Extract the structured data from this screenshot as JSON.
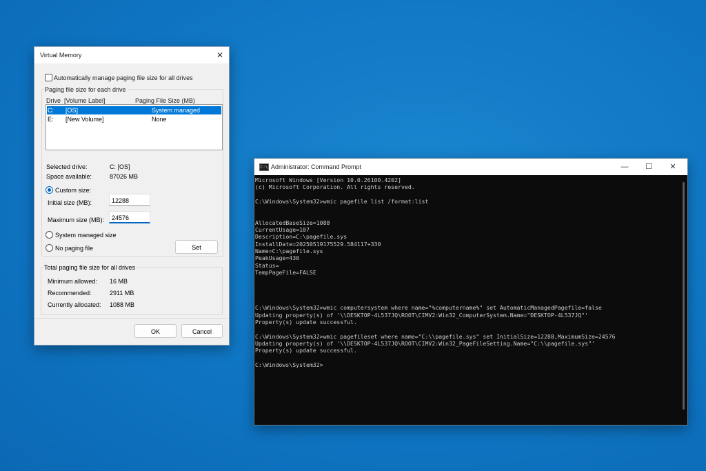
{
  "vm_dialog": {
    "title": "Virtual Memory",
    "auto_manage_label": "Automatically manage paging file size for all drives",
    "auto_manage_checked": false,
    "group_label": "Paging file size for each drive",
    "col_drive": "Drive",
    "col_volume": "[Volume Label]",
    "col_size": "Paging File Size (MB)",
    "drives": [
      {
        "drive": "C:",
        "label": "[OS]",
        "size": "System managed",
        "selected": true
      },
      {
        "drive": "E:",
        "label": "[New Volume]",
        "size": "None",
        "selected": false
      }
    ],
    "selected_drive_label": "Selected drive:",
    "selected_drive_value": "C:  [OS]",
    "space_available_label": "Space available:",
    "space_available_value": "87026 MB",
    "custom_size_label": "Custom size:",
    "initial_size_label": "Initial size (MB):",
    "initial_size_value": "12288",
    "max_size_label": "Maximum size (MB):",
    "max_size_value": "24576",
    "system_managed_label": "System managed size",
    "no_paging_label": "No paging file",
    "set_label": "Set",
    "total_group_label": "Total paging file size for all drives",
    "min_allowed_label": "Minimum allowed:",
    "min_allowed_value": "16 MB",
    "recommended_label": "Recommended:",
    "recommended_value": "2911 MB",
    "allocated_label": "Currently allocated:",
    "allocated_value": "1088 MB",
    "ok_label": "OK",
    "cancel_label": "Cancel"
  },
  "cmd_window": {
    "title": "Administrator: Command Prompt",
    "icon_text": "C:\\",
    "lines": [
      "Microsoft Windows [Version 10.0.26100.4202]",
      "(c) Microsoft Corporation. All rights reserved.",
      "",
      "C:\\Windows\\System32>wmic pagefile list /format:list",
      "",
      "",
      "AllocatedBaseSize=1088",
      "CurrentUsage=107",
      "Description=C:\\pagefile.sys",
      "InstallDate=20250519175529.584117+330",
      "Name=C:\\pagefile.sys",
      "PeakUsage=430",
      "Status=",
      "TempPageFile=FALSE",
      "",
      "",
      "",
      "",
      "C:\\Windows\\System32>wmic computersystem where name=\"%computername%\" set AutomaticManagedPagefile=false",
      "Updating property(s) of '\\\\DESKTOP-4L537JQ\\ROOT\\CIMV2:Win32_ComputerSystem.Name=\"DESKTOP-4L537JQ\"'",
      "Property(s) update successful.",
      "",
      "C:\\Windows\\System32>wmic pagefileset where name=\"C:\\\\pagefile.sys\" set InitialSize=12288,MaximumSize=24576",
      "Updating property(s) of '\\\\DESKTOP-4L537JQ\\ROOT\\CIMV2:Win32_PageFileSetting.Name=\"C:\\\\pagefile.sys\"'",
      "Property(s) update successful.",
      "",
      "C:\\Windows\\System32>"
    ]
  }
}
